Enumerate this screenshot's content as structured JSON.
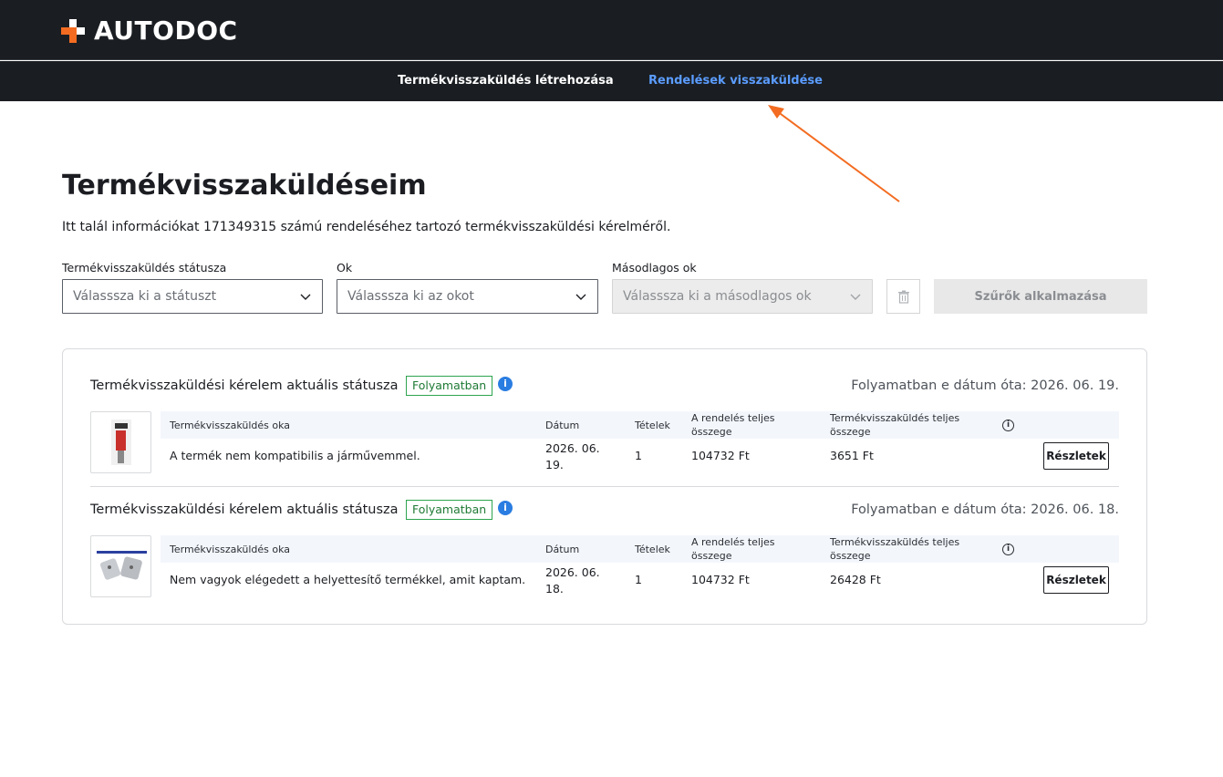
{
  "header": {
    "brand": "AUTODOC",
    "nav": {
      "create_return": "Termékvisszaküldés létrehozása",
      "order_returns": "Rendelések visszaküldése"
    }
  },
  "page": {
    "title": "Termékvisszaküldéseim",
    "description": "Itt talál információkat 171349315 számú rendeléséhez tartozó termékvisszaküldési kérelméről."
  },
  "filters": {
    "status_label": "Termékvisszaküldés státusza",
    "status_placeholder": "Válasssza ki a státuszt",
    "reason_label": "Ok",
    "reason_placeholder": "Válasssza ki az okot",
    "secondary_label": "Másodlagos ok",
    "secondary_placeholder": "Válasssza ki a másodlagos ok",
    "apply_label": "Szűrők alkalmazása"
  },
  "table_headers": {
    "reason": "Termékvisszaküldés oka",
    "date": "Dátum",
    "items": "Tételek",
    "order_total": "A rendelés teljes összege",
    "return_total": "Termékvisszaküldés teljes összege"
  },
  "returns": [
    {
      "status_label": "Termékvisszaküldési kérelem aktuális státusza",
      "status": "Folyamatban",
      "since": "Folyamatban e dátum óta: 2026. 06. 19.",
      "reason": "A termék nem kompatibilis a járművemmel.",
      "date_line1": "2026. 06.",
      "date_line2": "19.",
      "items": "1",
      "order_total": "104732 Ft",
      "return_total": "3651 Ft",
      "details_label": "Részletek"
    },
    {
      "status_label": "Termékvisszaküldési kérelem aktuális státusza",
      "status": "Folyamatban",
      "since": "Folyamatban e dátum óta: 2026. 06. 18.",
      "reason": "Nem vagyok elégedett a helyettesítő termékkel, amit kaptam.",
      "date_line1": "2026. 06.",
      "date_line2": "18.",
      "items": "1",
      "order_total": "104732 Ft",
      "return_total": "26428 Ft",
      "details_label": "Részletek"
    }
  ],
  "icons": {
    "info": "info-icon",
    "trash": "trash-icon",
    "chevron": "chevron-down-icon"
  },
  "colors": {
    "header_bg": "#1a1e22",
    "brand_orange": "#f36c21",
    "active_nav": "#5b9cff",
    "status_green": "#2da44e",
    "info_blue": "#2a7de1"
  }
}
